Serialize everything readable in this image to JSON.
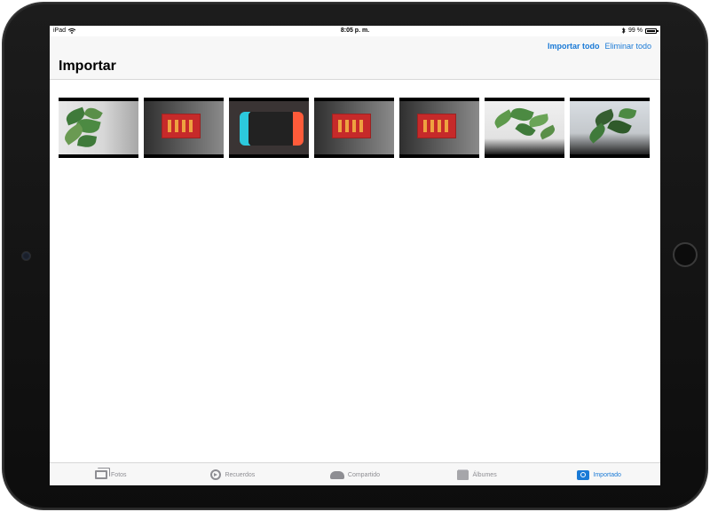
{
  "status": {
    "device": "iPad",
    "time": "8:05 p. m.",
    "battery": "99 %",
    "battery_level": 0.99
  },
  "nav": {
    "title": "Importar",
    "import_all": "Importar todo",
    "delete_all": "Eliminar todo"
  },
  "thumbnails": [
    {
      "subject": "plant"
    },
    {
      "subject": "red-box"
    },
    {
      "subject": "nintendo-switch"
    },
    {
      "subject": "red-box"
    },
    {
      "subject": "red-box"
    },
    {
      "subject": "plant"
    },
    {
      "subject": "plant"
    }
  ],
  "tabs": [
    {
      "label": "Fotos",
      "icon": "photos-icon",
      "active": false
    },
    {
      "label": "Recuerdos",
      "icon": "memories-icon",
      "active": false
    },
    {
      "label": "Compartido",
      "icon": "cloud-icon",
      "active": false
    },
    {
      "label": "Álbumes",
      "icon": "albums-icon",
      "active": false
    },
    {
      "label": "Importado",
      "icon": "camera-import-icon",
      "active": true
    }
  ],
  "colors": {
    "accent": "#1a7ad6",
    "tab_inactive": "#8e8e93",
    "bezel": "#111111"
  }
}
